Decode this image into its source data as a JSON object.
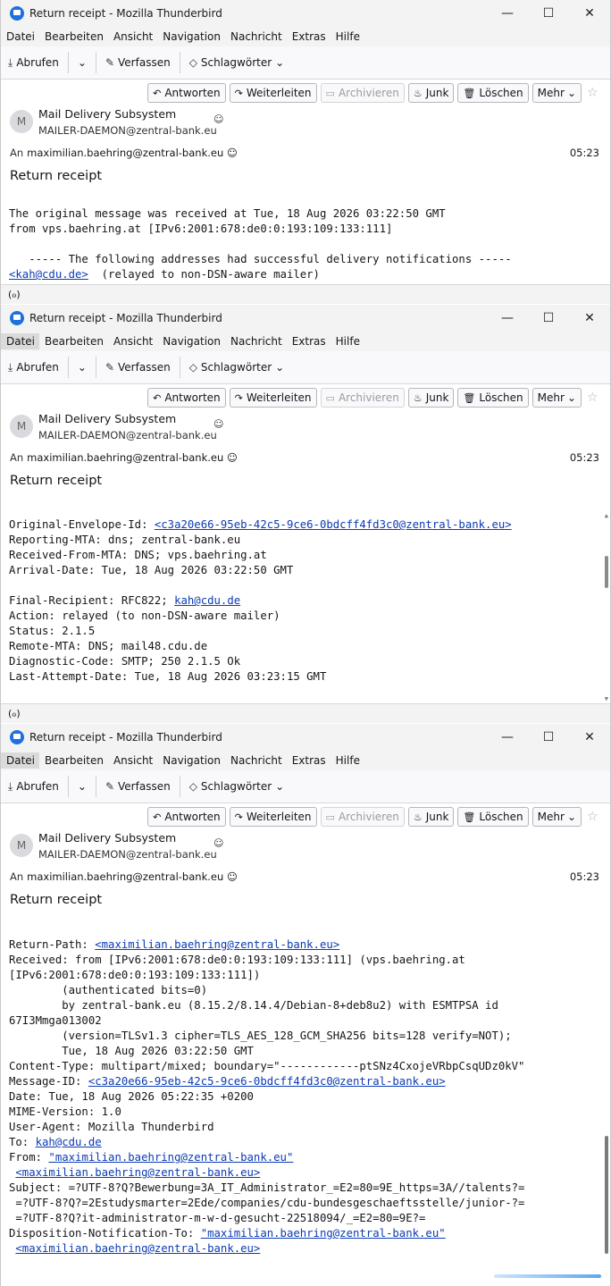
{
  "window": {
    "title": "Return receipt - Mozilla Thunderbird",
    "controls": {
      "minimize": "—",
      "maximize": "☐",
      "close": "✕"
    }
  },
  "menu": [
    "Datei",
    "Bearbeiten",
    "Ansicht",
    "Navigation",
    "Nachricht",
    "Extras",
    "Hilfe"
  ],
  "toolbar": {
    "fetch": "Abrufen",
    "compose": "Verfassen",
    "tags": "Schlagwörter"
  },
  "actions": {
    "reply": "Antworten",
    "forward": "Weiterleiten",
    "archive": "Archivieren",
    "junk": "Junk",
    "delete": "Löschen",
    "more": "Mehr"
  },
  "message": {
    "avatar": "M",
    "from_name": "Mail Delivery Subsystem",
    "from_addr": "MAILER-DAEMON@zentral-bank.eu",
    "to_label": "An",
    "to_addr": "maximilian.baehring@zentral-bank.eu",
    "time": "05:23",
    "subject": "Return receipt"
  },
  "body1": {
    "line1": "The original message was received at Tue, 18 Aug 2026 03:22:50 GMT",
    "line2": "from vps.baehring.at [IPv6:2001:678:de0:0:193:109:133:111]",
    "line3": "   ----- The following addresses had successful delivery notifications -----",
    "line4_link": "<kah@cdu.de>",
    "line4_rest": "  (relayed to non-DSN-aware mailer)"
  },
  "body2": {
    "envelope_label": "Original-Envelope-Id: ",
    "envelope_link": "<c3a20e66-95eb-42c5-9ce6-0bdcff4fd3c0@zentral-bank.eu>",
    "reporting": "Reporting-MTA: dns; zentral-bank.eu",
    "received_from": "Received-From-MTA: DNS; vps.baehring.at",
    "arrival": "Arrival-Date: Tue, 18 Aug 2026 03:22:50 GMT",
    "final_label": "Final-Recipient: RFC822; ",
    "final_link": "kah@cdu.de",
    "action": "Action: relayed (to non-DSN-aware mailer)",
    "status": "Status: 2.1.5",
    "remote": "Remote-MTA: DNS; mail48.cdu.de",
    "diag": "Diagnostic-Code: SMTP; 250 2.1.5 Ok",
    "last_attempt": "Last-Attempt-Date: Tue, 18 Aug 2026 03:23:15 GMT"
  },
  "body3": {
    "return_label": "Return-Path: ",
    "return_link": "<maximilian.baehring@zentral-bank.eu>",
    "received1": "Received: from [IPv6:2001:678:de0:0:193:109:133:111] (vps.baehring.at",
    "received2": "[IPv6:2001:678:de0:0:193:109:133:111])",
    "received3": "        (authenticated bits=0)",
    "received4": "        by zentral-bank.eu (8.15.2/8.14.4/Debian-8+deb8u2) with ESMTPSA id",
    "received5": "67I3Mmga013002",
    "received6": "        (version=TLSv1.3 cipher=TLS_AES_128_GCM_SHA256 bits=128 verify=NOT);",
    "received7": "        Tue, 18 Aug 2026 03:22:50 GMT",
    "content_type": "Content-Type: multipart/mixed; boundary=\"------------ptSNz4CxojeVRbpCsqUDz0kV\"",
    "msgid_label": "Message-ID: ",
    "msgid_link": "<c3a20e66-95eb-42c5-9ce6-0bdcff4fd3c0@zentral-bank.eu>",
    "date": "Date: Tue, 18 Aug 2026 05:22:35 +0200",
    "mime": "MIME-Version: 1.0",
    "ua": "User-Agent: Mozilla Thunderbird",
    "to_label": "To: ",
    "to_link": "kah@cdu.de",
    "from_label": "From: ",
    "from_link1": "\"maximilian.baehring@zentral-bank.eu\"",
    "from_link2": "<maximilian.baehring@zentral-bank.eu>",
    "subj1": "Subject: =?UTF-8?Q?Bewerbung=3A_IT_Administrator_=E2=80=9E_https=3A//talents?=",
    "subj2": " =?UTF-8?Q?=2Estudysmarter=2Ede/companies/cdu-bundesgeschaeftsstelle/junior-?=",
    "subj3": " =?UTF-8?Q?it-administrator-m-w-d-gesucht-22518094/_=E2=80=9E?=",
    "disp_label": "Disposition-Notification-To: ",
    "disp_link1": "\"maximilian.baehring@zentral-bank.eu\"",
    "disp_link2": "<maximilian.baehring@zentral-bank.eu>"
  },
  "status_icon": "(ℴ)"
}
